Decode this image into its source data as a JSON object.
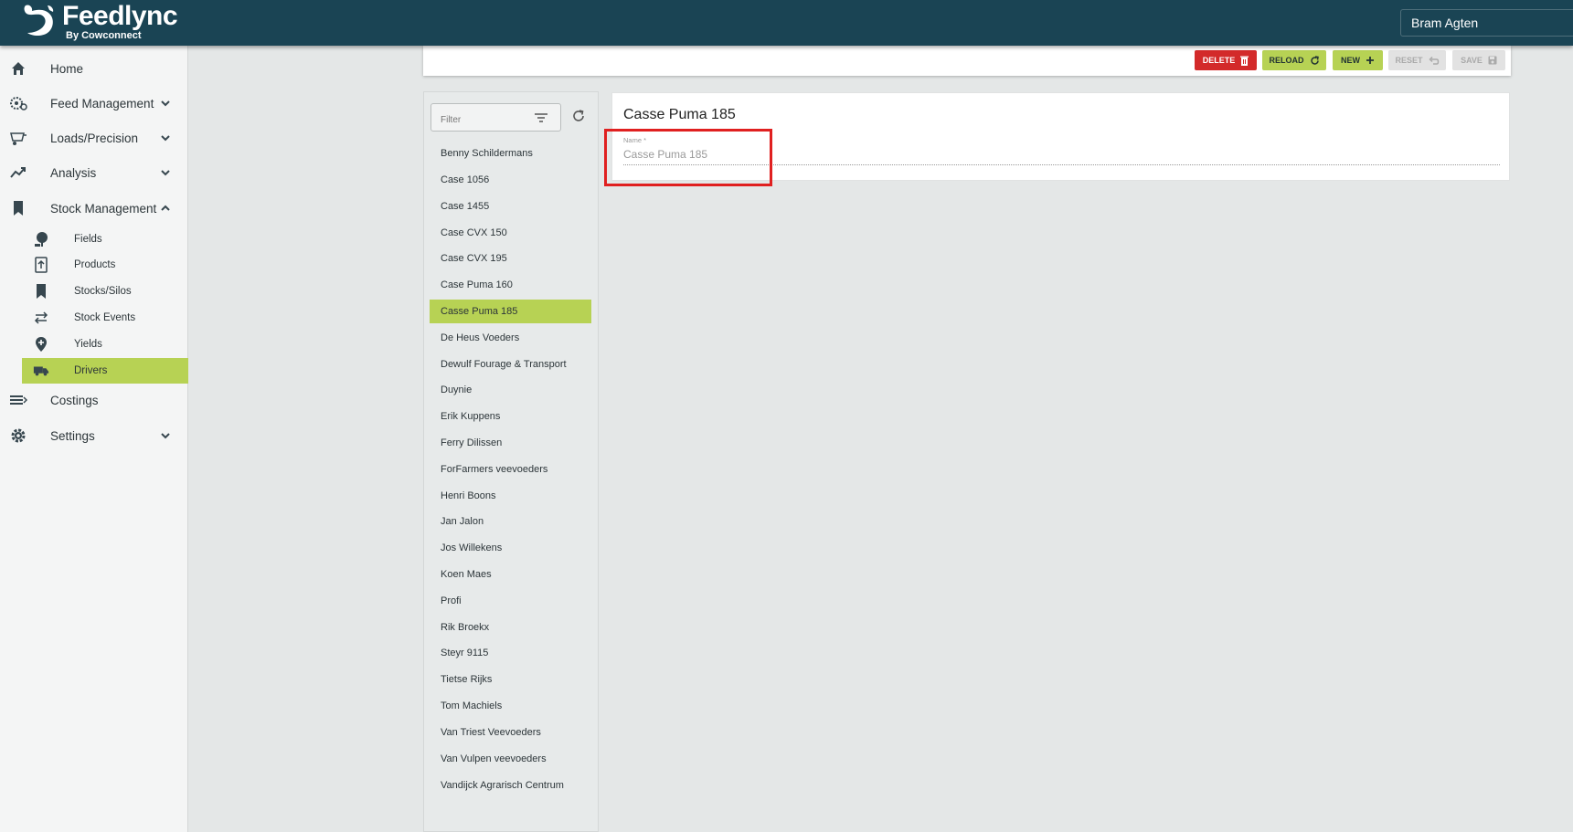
{
  "app": {
    "brand": "Feedlync",
    "brand_sub": "By Cowconnect",
    "user_name": "Bram Agten"
  },
  "sidebar": {
    "items": [
      {
        "label": "Home",
        "icon": "home-icon",
        "expandable": false
      },
      {
        "label": "Feed Management",
        "icon": "feed-gears-icon",
        "expandable": true,
        "expanded": false
      },
      {
        "label": "Loads/Precision",
        "icon": "mixer-wagon-icon",
        "expandable": true,
        "expanded": false
      },
      {
        "label": "Analysis",
        "icon": "trend-icon",
        "expandable": true,
        "expanded": false
      },
      {
        "label": "Stock Management",
        "icon": "bookmark-icon",
        "expandable": true,
        "expanded": true
      },
      {
        "label": "Costings",
        "icon": "costings-icon",
        "expandable": false
      },
      {
        "label": "Settings",
        "icon": "gear-icon",
        "expandable": true,
        "expanded": false
      }
    ],
    "sub_items": [
      {
        "label": "Fields",
        "icon": "tree-icon"
      },
      {
        "label": "Products",
        "icon": "product-bag-icon"
      },
      {
        "label": "Stocks/Silos",
        "icon": "bookmark-icon"
      },
      {
        "label": "Stock Events",
        "icon": "swap-arrows-icon"
      },
      {
        "label": "Yields",
        "icon": "map-pin-plus-icon"
      },
      {
        "label": "Drivers",
        "icon": "truck-icon",
        "active": true
      }
    ]
  },
  "toolbar": {
    "delete_label": "DELETE",
    "reload_label": "RELOAD",
    "new_label": "NEW",
    "reset_label": "RESET",
    "save_label": "SAVE",
    "colors": {
      "delete": "#d32a2a",
      "accent": "#b7d254",
      "disabled": "#e2e2e2"
    }
  },
  "list": {
    "filter_label": "Filter",
    "items": [
      "Benny Schildermans",
      "Case 1056",
      "Case 1455",
      "Case CVX 150",
      "Case CVX 195",
      "Case Puma 160",
      "Casse Puma 185",
      "De Heus Voeders",
      "Dewulf Fourage & Transport",
      "Duynie",
      "Erik Kuppens",
      "Ferry Dilissen",
      "ForFarmers veevoeders",
      "Henri Boons",
      "Jan Jalon",
      "Jos Willekens",
      "Koen Maes",
      "Profi",
      "Rik Broekx",
      "Steyr 9115",
      "Tietse Rijks",
      "Tom Machiels",
      "Van Triest Veevoeders",
      "Van Vulpen veevoeders",
      "Vandijck Agrarisch Centrum"
    ],
    "selected": "Casse Puma 185"
  },
  "detail": {
    "title": "Casse Puma 185",
    "name_label": "Name *",
    "name_value": "Casse Puma 185"
  },
  "colors": {
    "topbar": "#1a4454",
    "accent": "#b7d254",
    "highlight": "#e02020"
  }
}
